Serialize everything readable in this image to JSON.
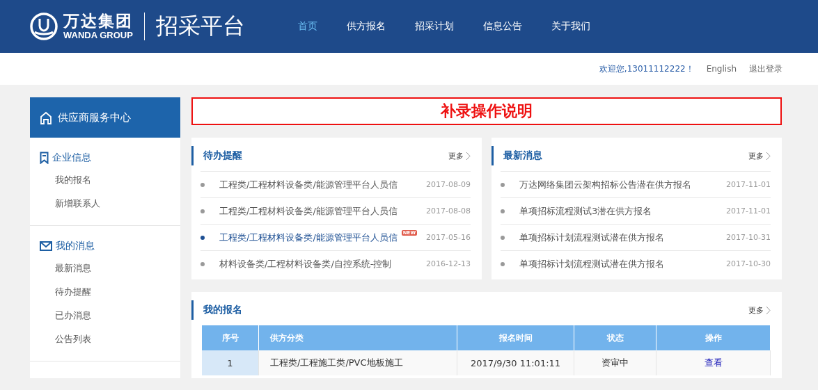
{
  "header": {
    "logo_cn": "万达集团",
    "logo_en": "WANDA GROUP",
    "platform": "招采平台",
    "nav": [
      {
        "label": "首页",
        "selected": true
      },
      {
        "label": "供方报名",
        "selected": false
      },
      {
        "label": "招采计划",
        "selected": false
      },
      {
        "label": "信息公告",
        "selected": false
      },
      {
        "label": "关于我们",
        "selected": false
      }
    ]
  },
  "user_bar": {
    "welcome": "欢迎您,13011112222！",
    "language": "English",
    "logout": "退出登录"
  },
  "sidebar": {
    "title": "供应商服务中心",
    "groups": [
      {
        "kind": "bookmark",
        "title": "企业信息",
        "items": [
          "我的报名",
          "新增联系人"
        ]
      },
      {
        "kind": "mail",
        "title": "我的消息",
        "items": [
          "最新消息",
          "待办提醒",
          "已办消息",
          "公告列表"
        ]
      }
    ]
  },
  "banner": "补录操作说明",
  "todo": {
    "title": "待办提醒",
    "more": "更多",
    "items": [
      {
        "text": "工程类/工程材料设备类/能源管理平台人员信",
        "date": "2017-08-09",
        "new": false
      },
      {
        "text": "工程类/工程材料设备类/能源管理平台人员信",
        "date": "2017-08-08",
        "new": false
      },
      {
        "text": "工程类/工程材料设备类/能源管理平台人员信",
        "date": "2017-05-16",
        "new": true,
        "badge": "NEW"
      },
      {
        "text": "材料设备类/工程材料设备类/自控系统-控制",
        "date": "2016-12-13",
        "new": false
      }
    ]
  },
  "news": {
    "title": "最新消息",
    "more": "更多",
    "items": [
      {
        "text": "万达网络集团云架构招标公告潜在供方报名",
        "date": "2017-11-01",
        "new": false
      },
      {
        "text": "单项招标流程测试3潜在供方报名",
        "date": "2017-11-01",
        "new": false
      },
      {
        "text": "单项招标计划流程测试潜在供方报名",
        "date": "2017-10-31",
        "new": false
      },
      {
        "text": "单项招标计划流程测试潜在供方报名",
        "date": "2017-10-30",
        "new": false
      }
    ]
  },
  "registrations": {
    "title": "我的报名",
    "more": "更多",
    "columns": [
      "序号",
      "供方分类",
      "报名时间",
      "状态",
      "操作"
    ],
    "rows": [
      {
        "number": "1",
        "category": "工程类/工程施工类/PVC地板施工",
        "time": "2017/9/30 11:01:11",
        "status": "资审中",
        "action": "查看"
      }
    ]
  }
}
